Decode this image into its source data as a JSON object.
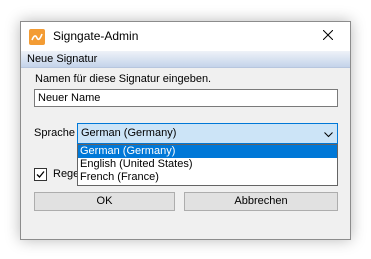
{
  "window": {
    "title": "Signgate-Admin",
    "icon": "signgate-app-icon",
    "close_icon": "close-icon"
  },
  "subheader": {
    "title": "Neue Signatur"
  },
  "form": {
    "instruction": "Namen für diese Signatur eingeben.",
    "name_value": "Neuer Name",
    "language_label": "Sprache",
    "language_selected": "German (Germany)",
    "language_options": [
      "German (Germany)",
      "English (United States)",
      "French (France)"
    ],
    "checkbox_label": "Rege",
    "checkbox_checked": true
  },
  "buttons": {
    "ok": "OK",
    "cancel": "Abbrechen"
  },
  "colors": {
    "selection": "#0078d7",
    "select_bg": "#cce4f7",
    "header_gradient_bottom": "#c4d3ea",
    "app_icon": "#f39c34"
  }
}
